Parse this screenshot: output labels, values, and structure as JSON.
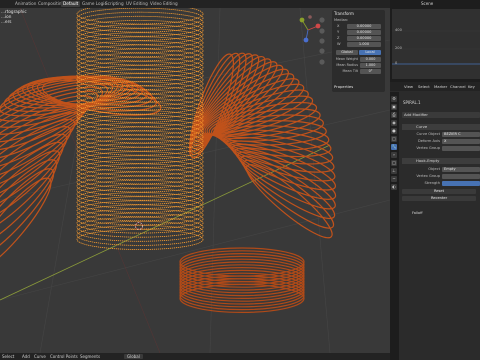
{
  "workspace_tabs": [
    "Animation",
    "Compositing",
    "Default",
    "Game Logic",
    "Scripting",
    "UV Editing",
    "Video Editing"
  ],
  "active_tab_index": 2,
  "viewport": {
    "info_line1": "...rtographic",
    "info_line2": "...ion",
    "info_line3": "...ers"
  },
  "npanel": {
    "section": "Transform",
    "subsection": "Median:",
    "x_label": "X",
    "x_value": "0.00000",
    "y_label": "Y",
    "y_value": "0.00000",
    "z_label": "Z",
    "z_value": "0.00000",
    "w_label": "W",
    "w_value": "1.000",
    "global_label": "Global",
    "local_label": "Local",
    "mean_weight_label": "Mean Weight",
    "mean_weight_value": "0.000",
    "mean_radius_label": "Mean Radius",
    "mean_radius_value": "1.000",
    "mean_tilt_label": "Mean Tilt",
    "mean_tilt_value": "0°",
    "properties_section": "Properties"
  },
  "right_top": {
    "scene_label": "Scene",
    "graph_tick_1": "400",
    "graph_tick_2": "200",
    "graph_tick_3": "0"
  },
  "properties": {
    "header_items": [
      "View",
      "Select",
      "Marker",
      "Channel",
      "Key"
    ],
    "object_name": "SPIRAL.1",
    "add_modifier": "Add Modifier",
    "mod1_name": "Curve",
    "curve_object_label": "Curve Object",
    "curve_object_value": "BÉZIER C",
    "deform_axis_label": "Deform Axis",
    "deform_axis_value": "X",
    "vertex_group_label": "Vertex Group",
    "mod2_name": "Hook-Empty",
    "object_label": "Object",
    "object_value": "Empty",
    "vertex_group2_label": "Vertex Group",
    "strength_label": "Strength",
    "reset_label": "Reset",
    "recenter_label": "Recenter",
    "falloff_label": "Falloff"
  },
  "bottom_bar": {
    "items": [
      "Select",
      "Add",
      "Curve",
      "Control Points",
      "Segments"
    ],
    "transform_orientation": "Global"
  },
  "colors": {
    "accent_blue": "#4772b3",
    "spring_orange": "#c0521b",
    "selected_orange": "#ffa030",
    "viewport_bg": "#393939"
  }
}
